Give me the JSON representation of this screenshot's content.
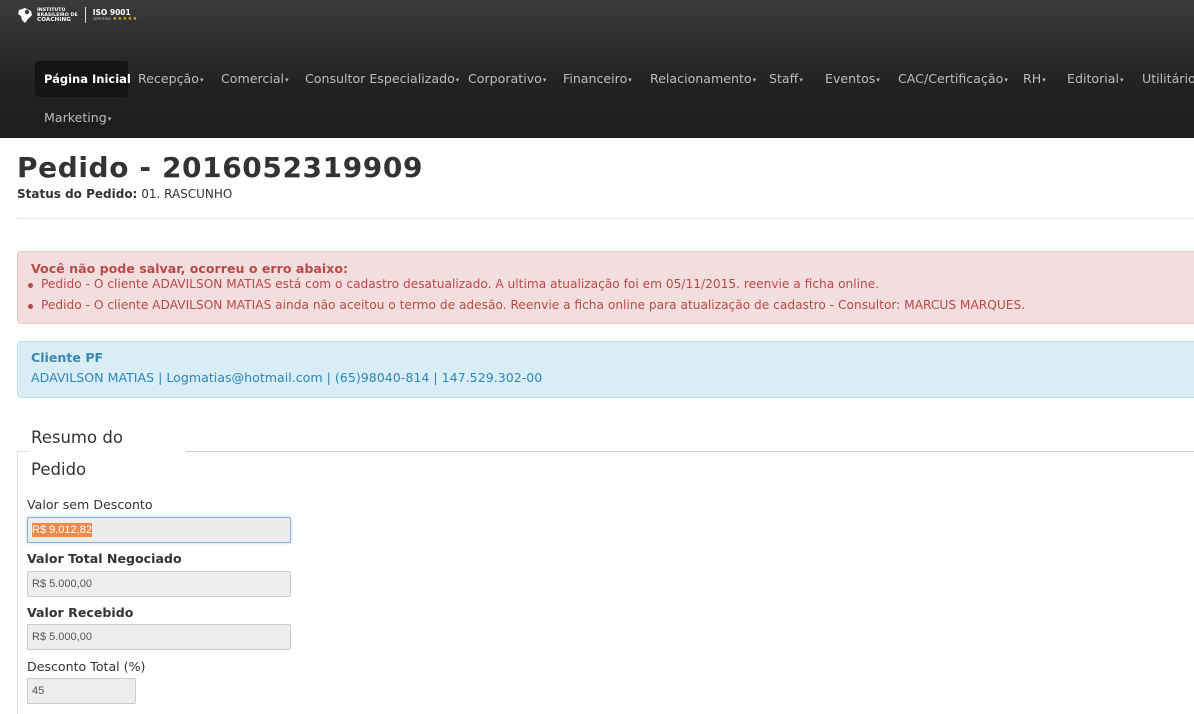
{
  "brand": {
    "logo_line1": "INSTITUTO",
    "logo_line2": "BRASILEIRO DE",
    "logo_line3": "COACHING",
    "iso_title": "ISO 9001",
    "iso_sub": "CERTIFIED",
    "iso_stars": "★★★★★"
  },
  "nav": {
    "items": [
      {
        "label": "Página Inicial",
        "active": true
      },
      {
        "label": "Recepção"
      },
      {
        "label": "Comercial"
      },
      {
        "label": "Consultor Especializado"
      },
      {
        "label": "Corporativo"
      },
      {
        "label": "Financeiro"
      },
      {
        "label": "Relacionamento"
      },
      {
        "label": "Staff"
      },
      {
        "label": "Eventos"
      },
      {
        "label": "CAC/Certificação"
      },
      {
        "label": "RH"
      },
      {
        "label": "Editorial"
      },
      {
        "label": "Utilitários"
      },
      {
        "label": "Marketing"
      }
    ],
    "caret": "▾"
  },
  "header": {
    "title": "Pedido - 2016052319909",
    "status_label": "Status do Pedido:",
    "status_value": "01. RASCUNHO"
  },
  "error_alert": {
    "heading": "Você não pode salvar, ocorreu o erro abaixo:",
    "errors": [
      "Pedido - O cliente ADAVILSON MATIAS está com o cadastro desatualizado. A ultima atualização foi em 05/11/2015. reenvie a ficha online.",
      "Pedido - O cliente ADAVILSON MATIAS ainda não aceitou o termo de adesão. Reenvie a ficha online para atualização de cadastro - Consultor: MARCUS MARQUES."
    ]
  },
  "client_alert": {
    "heading": "Cliente PF",
    "details": "ADAVILSON MATIAS | Logmatias@hotmail.com | (65)98040-814 | 147.529.302-00"
  },
  "summary": {
    "legend_line1": "Resumo do",
    "legend_line2": "Pedido",
    "fields": {
      "valor_sem_desconto": {
        "label": "Valor sem Desconto",
        "value": "R$ 9.012,82"
      },
      "valor_total_negociado": {
        "label": "Valor Total Negociado",
        "value": "R$ 5.000,00"
      },
      "valor_recebido": {
        "label": "Valor Recebido",
        "value": "R$ 5.000,00"
      },
      "desconto_total": {
        "label": "Desconto Total (%)",
        "value": "45"
      }
    }
  },
  "colors": {
    "navbar_bg": "#262626",
    "error_bg": "#f2dede",
    "error_text": "#b94a48",
    "info_bg": "#d9edf7",
    "info_text": "#3a87ad",
    "selection": "#f08a4b"
  }
}
